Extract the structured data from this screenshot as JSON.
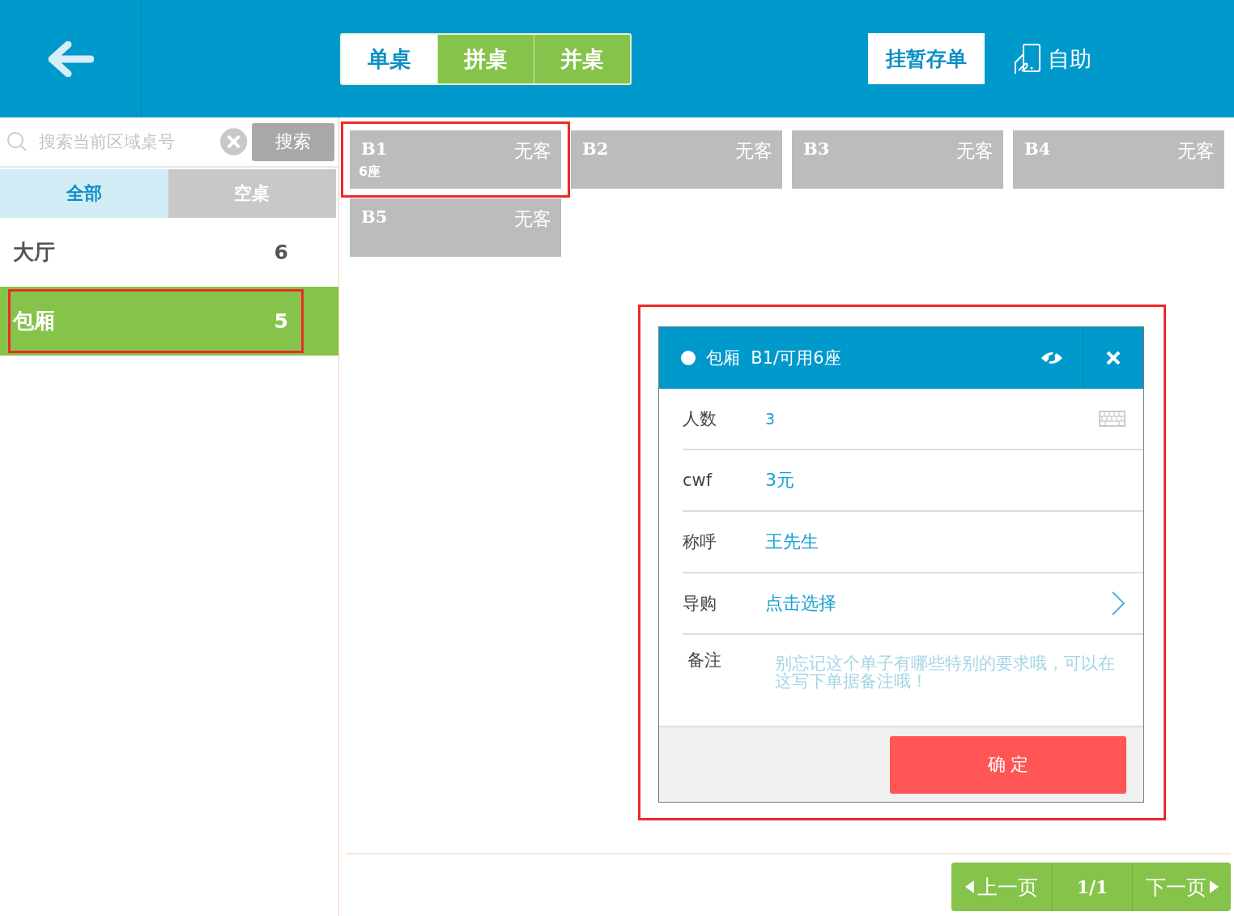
{
  "table_modes": [
    {
      "label": "单桌",
      "selected": true
    },
    {
      "label": "拼桌",
      "selected": false
    },
    {
      "label": "并桌",
      "selected": false
    }
  ],
  "hold_button": "挂暂存单",
  "self_service": "自助",
  "search": {
    "placeholder": "搜索当前区域桌号",
    "button": "搜索"
  },
  "filters": [
    {
      "label": "全部",
      "selected": true
    },
    {
      "label": "空桌",
      "selected": false
    }
  ],
  "areas": [
    {
      "name": "大厅",
      "count": "6",
      "selected": false,
      "highlighted": false
    },
    {
      "name": "包厢",
      "count": "5",
      "selected": true,
      "highlighted": true
    }
  ],
  "tables": [
    {
      "name": "B1",
      "status": "无客",
      "seats": "6座",
      "highlighted": true
    },
    {
      "name": "B2",
      "status": "无客",
      "highlighted": false
    },
    {
      "name": "B3",
      "status": "无客",
      "highlighted": false
    },
    {
      "name": "B4",
      "status": "无客",
      "highlighted": false
    },
    {
      "name": "B5",
      "status": "无客",
      "highlighted": false
    }
  ],
  "dialog": {
    "highlighted": true,
    "area": "包厢",
    "title": "B1/可用6座",
    "fields": [
      {
        "kind": "number",
        "label": "人数",
        "value": "3"
      },
      {
        "kind": "text",
        "label": "cwf",
        "value": "3元"
      },
      {
        "kind": "text",
        "label": "称呼",
        "value": "王先生"
      },
      {
        "kind": "select",
        "label": "导购",
        "value": "点击选择"
      },
      {
        "kind": "note",
        "label": "备注",
        "placeholder": "别忘记这个单子有哪些特别的要求哦，可以在这写下单据备注哦！"
      }
    ],
    "confirm": "确 定"
  },
  "pagination": {
    "prev": "上一页",
    "page": "1/1",
    "next": "下一页"
  }
}
